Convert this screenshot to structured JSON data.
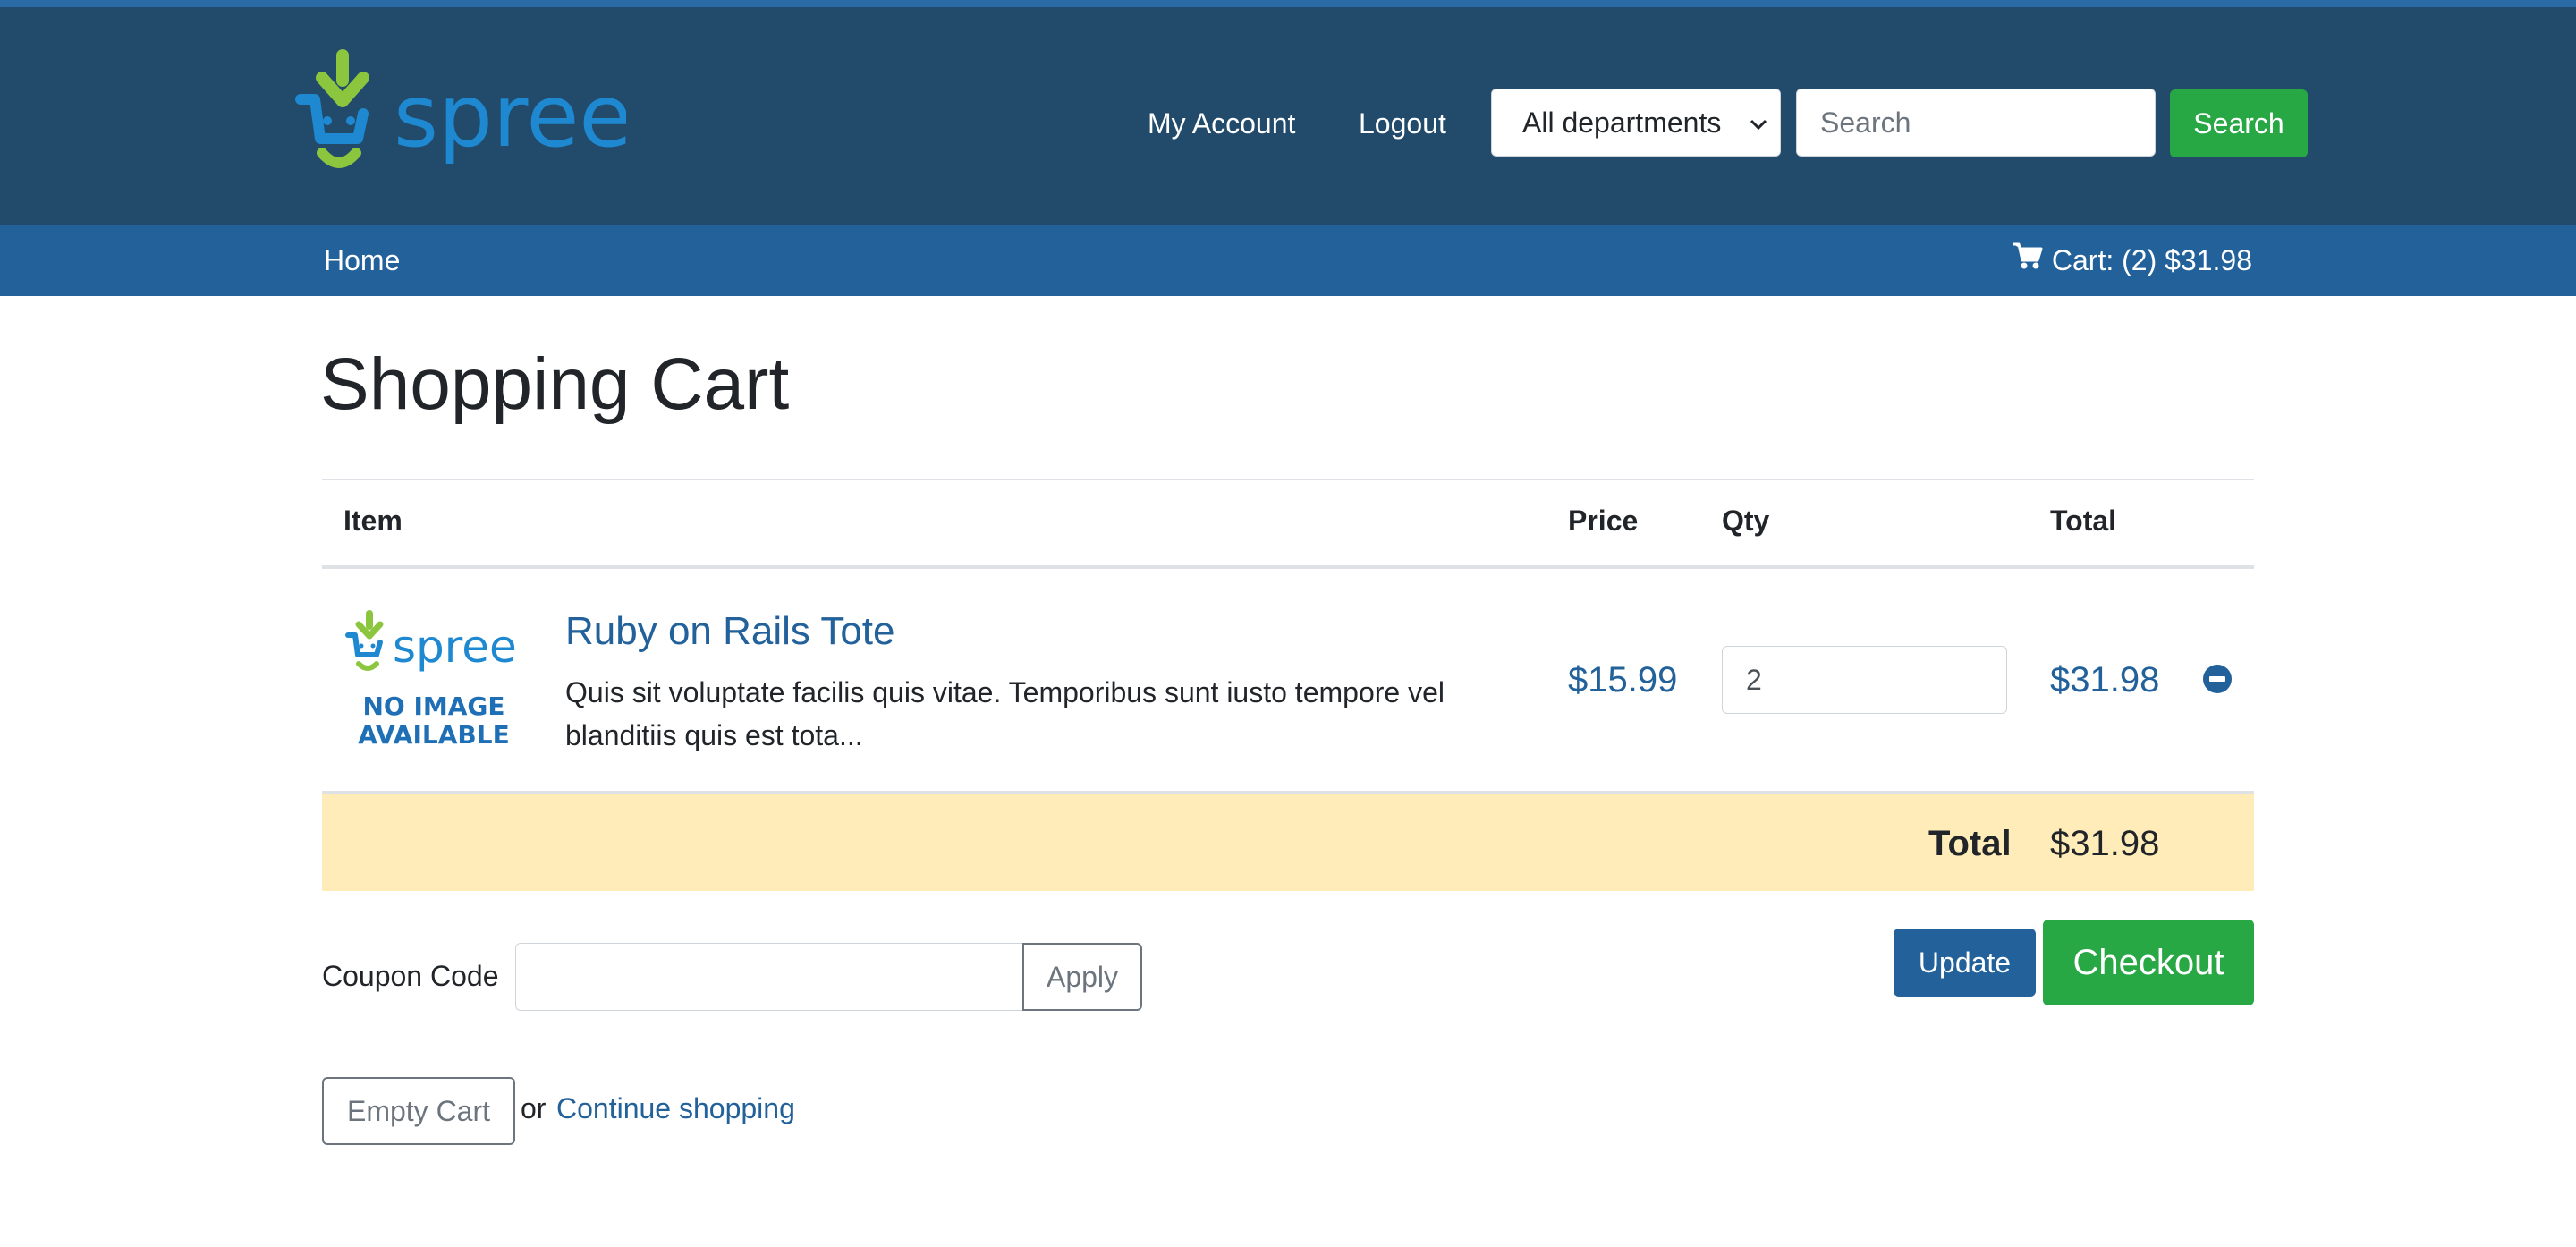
{
  "brand": {
    "logo_text": "spree",
    "colors": {
      "header": "#224a6b",
      "subnav": "#22619a",
      "accent_green": "#28a745",
      "link_blue": "#22619a",
      "total_bar": "#ffecb8"
    }
  },
  "header": {
    "my_account": "My Account",
    "logout": "Logout",
    "department_select": "All departments",
    "search_placeholder": "Search",
    "search_button": "Search"
  },
  "subnav": {
    "home": "Home",
    "cart": "Cart: (2) $31.98"
  },
  "page": {
    "title": "Shopping Cart"
  },
  "cart_table": {
    "columns": [
      "Item",
      "Price",
      "Qty",
      "Total"
    ],
    "rows": [
      {
        "image_logo_text": "spree",
        "image_text_line1": "NO IMAGE",
        "image_text_line2": "AVAILABLE",
        "name": "Ruby on Rails Tote",
        "description": "Quis sit voluptate facilis quis vitae. Temporibus sunt iusto tempore vel blanditiis quis est tota...",
        "price": "$15.99",
        "qty": "2",
        "total": "$31.98",
        "remove_icon": "minus-circle-icon"
      }
    ],
    "total_label": "Total",
    "total_value": "$31.98"
  },
  "coupon": {
    "label": "Coupon Code",
    "value": "",
    "apply_button": "Apply"
  },
  "actions": {
    "update_button": "Update",
    "checkout_button": "Checkout",
    "empty_cart_button": "Empty Cart",
    "or_text": "or",
    "continue_shopping": "Continue shopping"
  }
}
